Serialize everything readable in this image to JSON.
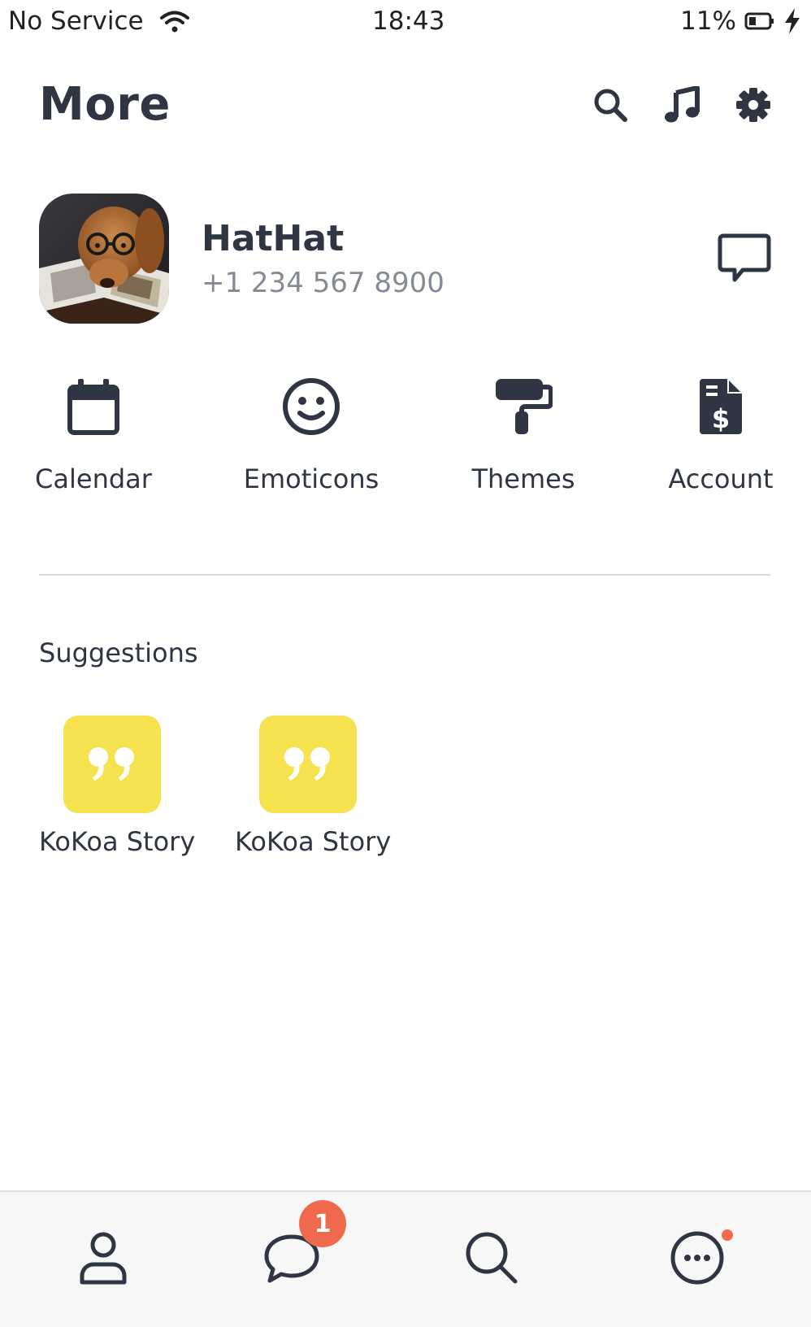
{
  "status_bar": {
    "carrier": "No Service",
    "time": "18:43",
    "battery": "11%"
  },
  "header": {
    "title": "More",
    "icons": [
      "search-icon",
      "music-icon",
      "gear-icon"
    ]
  },
  "profile": {
    "name": "HatHat",
    "phone": "+1 234 567 8900"
  },
  "actions": [
    {
      "label": "Calendar",
      "icon": "calendar-icon"
    },
    {
      "label": "Emoticons",
      "icon": "smiley-icon"
    },
    {
      "label": "Themes",
      "icon": "paint-roller-icon"
    },
    {
      "label": "Account",
      "icon": "invoice-dollar-icon"
    }
  ],
  "suggestions": {
    "title": "Suggestions",
    "items": [
      {
        "label": "KoKoa Story",
        "icon": "quote-icon"
      },
      {
        "label": "KoKoa Story",
        "icon": "quote-icon"
      }
    ]
  },
  "tab_bar": {
    "tabs": [
      "person-icon",
      "chat-icon",
      "search-icon",
      "more-icon"
    ],
    "chat_badge": "1"
  },
  "colors": {
    "text": "#2f3542",
    "muted": "#858a94",
    "accent_yellow": "#f5e24e",
    "badge": "#ef6a4c"
  }
}
